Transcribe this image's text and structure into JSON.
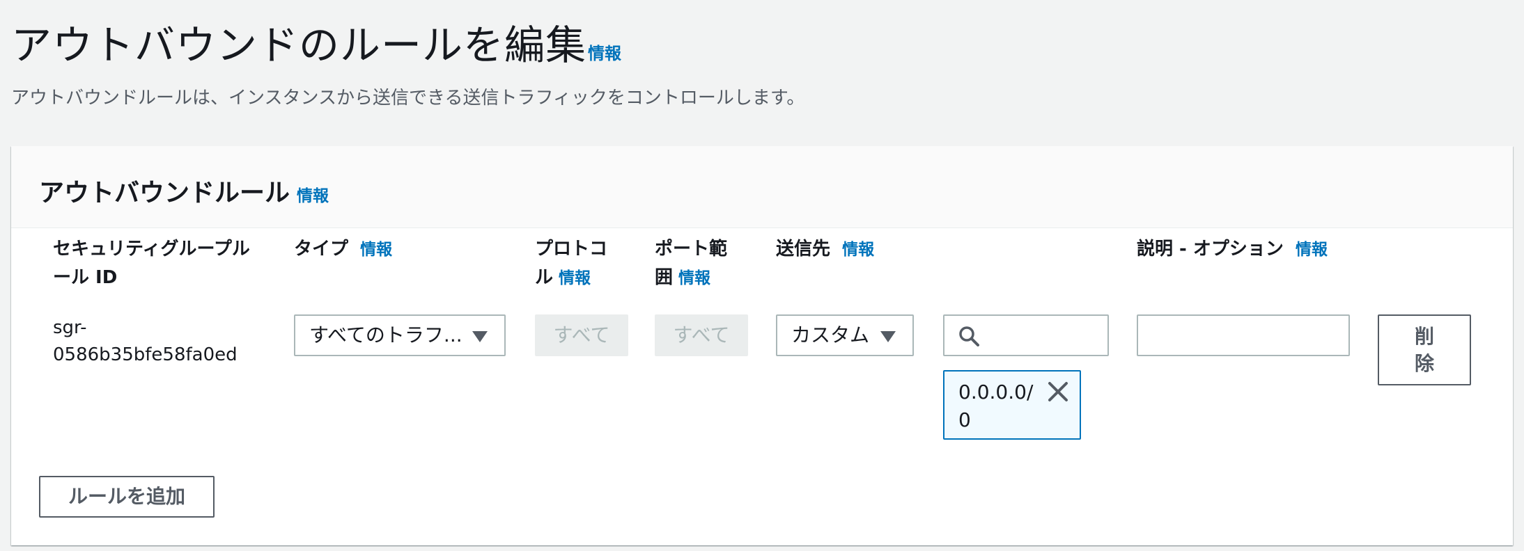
{
  "page": {
    "title": "アウトバウンドのルールを編集",
    "title_info": "情報",
    "description": "アウトバウンドルールは、インスタンスから送信できる送信トラフィックをコントロールします。"
  },
  "panel": {
    "title": "アウトバウンドルール",
    "title_info": "情報"
  },
  "columns": {
    "rule_id": {
      "line1": "セキュリティグループル",
      "line2": "ール ID"
    },
    "type": {
      "label": "タイプ",
      "info": "情報"
    },
    "protocol": {
      "line1": "プロトコ",
      "line2": "ル",
      "info": "情報"
    },
    "port_range": {
      "line1": "ポート範",
      "line2": "囲",
      "info": "情報"
    },
    "destination": {
      "label": "送信先",
      "info": "情報"
    },
    "description": {
      "label": "説明 - オプション",
      "info": "情報"
    }
  },
  "rule": {
    "id_line1": "sgr-",
    "id_line2": "0586b35bfe58fa0ed",
    "type_value": "すべてのトラフ...",
    "protocol_value": "すべて",
    "port_value": "すべて",
    "destination_type": "カスタム",
    "destination_search_value": "",
    "cidr_token_line1": "0.0.0.0/",
    "cidr_token_line2": "0",
    "description_value": "",
    "delete_line1": "削",
    "delete_line2": "除"
  },
  "actions": {
    "add_rule": "ルールを追加"
  },
  "colors": {
    "link": "#0073bb",
    "token_border": "#0073bb",
    "token_bg": "#f1faff",
    "disabled_bg": "#eaeded"
  }
}
